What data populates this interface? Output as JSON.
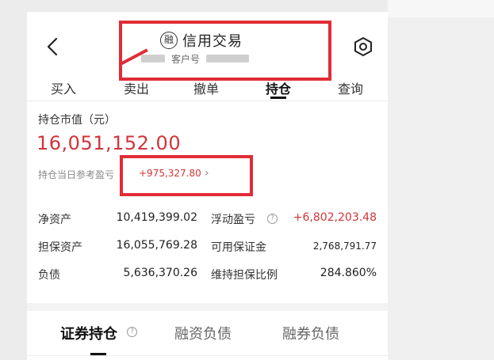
{
  "header": {
    "title": "信用交易",
    "title_badge": "融",
    "account_label": "客户号",
    "back_icon": "chevron-left-icon",
    "settings_icon": "hexagon-gear-icon"
  },
  "tabs": [
    {
      "label": "买入",
      "active": false
    },
    {
      "label": "卖出",
      "active": false
    },
    {
      "label": "撤单",
      "active": false
    },
    {
      "label": "持仓",
      "active": true
    },
    {
      "label": "查询",
      "active": false
    }
  ],
  "summary": {
    "market_value_label": "持仓市值（元）",
    "market_value": "16,051,152.00",
    "daily_pnl_label": "持仓当日参考盈亏",
    "daily_pnl": "+975,327.80",
    "chevron": "›"
  },
  "stats": {
    "net_assets_label": "净资产",
    "net_assets": "10,419,399.02",
    "floating_pnl_label": "浮动盈亏",
    "floating_pnl": "+6,802,203.48",
    "collateral_label": "担保资产",
    "collateral": "16,055,769.28",
    "available_margin_label": "可用保证金",
    "available_margin": "2,768,791.77",
    "liabilities_label": "负债",
    "liabilities": "5,636,370.26",
    "maintenance_ratio_label": "维持担保比例",
    "maintenance_ratio": "284.860%",
    "help_glyph": "?"
  },
  "bottom_tabs": [
    {
      "label": "证券持仓",
      "active": true
    },
    {
      "label": "融资负债",
      "active": false
    },
    {
      "label": "融券负债",
      "active": false
    }
  ],
  "colors": {
    "accent_red": "#d2343a",
    "annotation_red": "#e12c36"
  }
}
